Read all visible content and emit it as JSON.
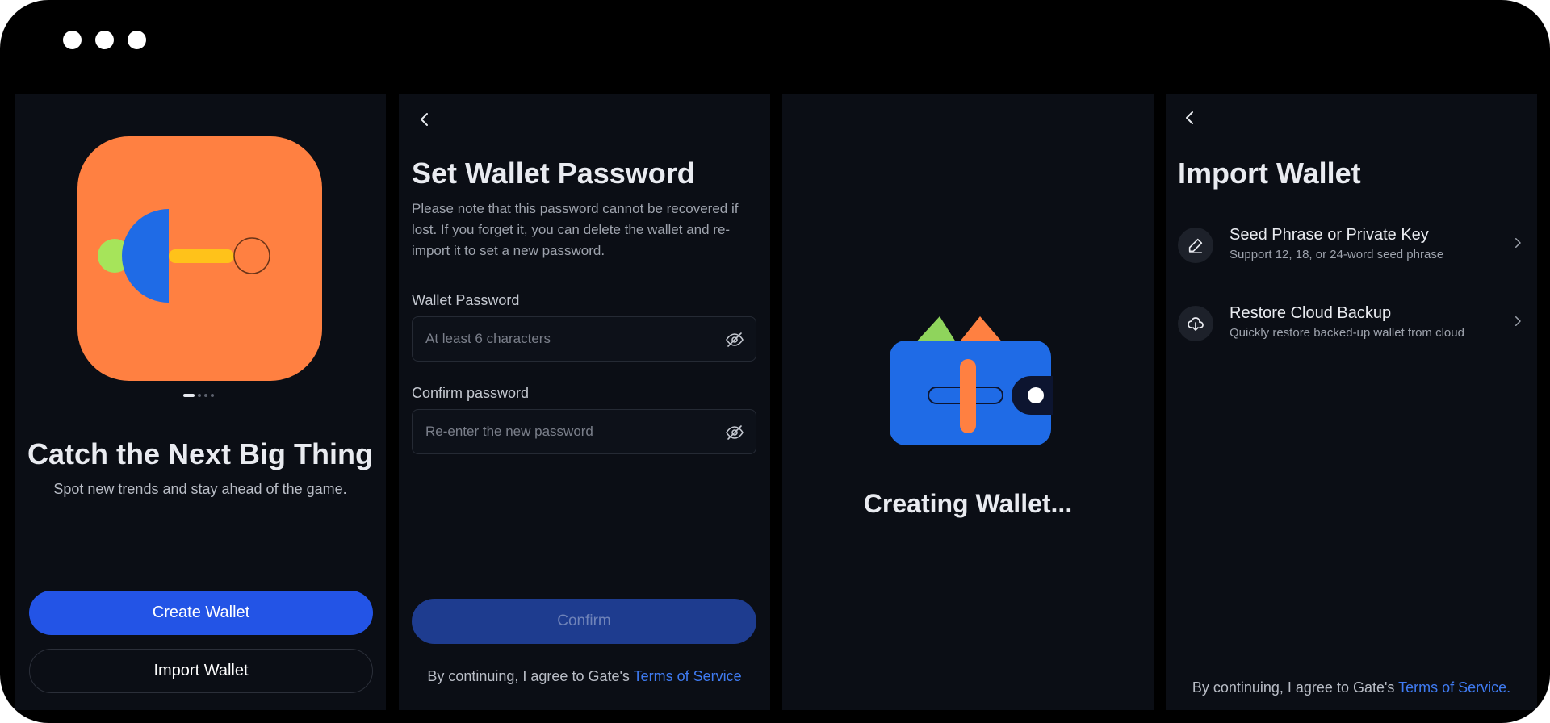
{
  "window": {
    "controls": [
      "dot",
      "dot",
      "dot"
    ]
  },
  "screen1": {
    "title": "Catch the Next Big Thing",
    "subtitle": "Spot new trends and stay ahead of the game.",
    "create_button": "Create Wallet",
    "import_button": "Import Wallet",
    "pager": {
      "total": 4,
      "active": 1
    },
    "icon_colors": {
      "background": "#ff8041",
      "blue": "#1f6be6",
      "green": "#a6e45a",
      "yellow": "#ffc21a"
    }
  },
  "screen2": {
    "title": "Set Wallet Password",
    "note": "Please note that this password cannot be recovered if lost. If you forget it, you can delete the wallet and re-import it to set a new password.",
    "password_label": "Wallet Password",
    "password_placeholder": "At least 6 characters",
    "confirm_label": "Confirm password",
    "confirm_placeholder": "Re-enter the new password",
    "confirm_button": "Confirm",
    "terms_prefix": "By continuing, I agree to Gate's",
    "terms_link": "Terms of Service"
  },
  "screen3": {
    "status": "Creating Wallet..."
  },
  "screen4": {
    "title": "Import Wallet",
    "options": [
      {
        "title": "Seed Phrase or Private Key",
        "subtitle": "Support 12, 18, or 24-word seed phrase",
        "icon": "pen-icon"
      },
      {
        "title": "Restore Cloud Backup",
        "subtitle": "Quickly restore backed-up wallet from cloud",
        "icon": "cloud-download-icon"
      }
    ],
    "terms_prefix": "By continuing, I agree to Gate's",
    "terms_link": "Terms of Service."
  },
  "colors": {
    "accent": "#2354e6",
    "link": "#3f7bf2",
    "screen_bg": "#0b0e15"
  }
}
